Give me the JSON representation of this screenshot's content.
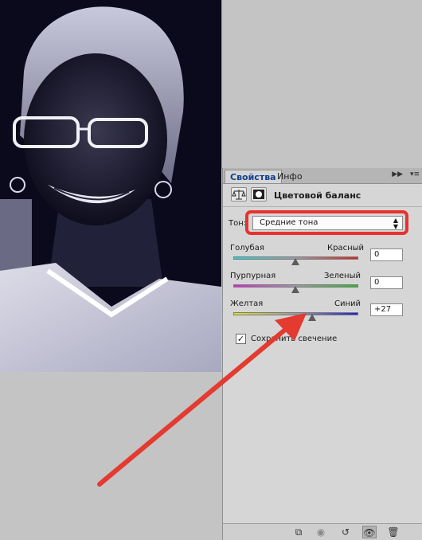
{
  "panel": {
    "tabs": [
      {
        "label": "Свойства",
        "active": true
      },
      {
        "label": "Инфо",
        "active": false
      }
    ],
    "title": "Цветовой баланс",
    "tone_label": "Тон:",
    "tone_value": "Средние тона",
    "sliders": [
      {
        "left_label": "Голубая",
        "right_label": "Красный",
        "value": "0",
        "level": 0
      },
      {
        "left_label": "Пурпурная",
        "right_label": "Зеленый",
        "value": "0",
        "level": 0
      },
      {
        "left_label": "Желтая",
        "right_label": "Синий",
        "value": "+27",
        "level": 27
      }
    ],
    "preserve_luminosity": {
      "label": "Сохранить свечение",
      "checked": true
    }
  },
  "icons": {
    "balance": "balance-scale-icon",
    "mask": "mask-icon",
    "clip": "clip-to-layer-icon",
    "view_previous": "view-previous-icon",
    "reset": "reset-icon",
    "visibility": "eye-icon",
    "delete": "trash-icon",
    "menu": "panel-menu-icon",
    "collapse": "collapse-icon"
  },
  "colors": {
    "highlight": "#e8322e",
    "arrow": "#e43a30",
    "photo_bg": "#0b0a1c"
  }
}
